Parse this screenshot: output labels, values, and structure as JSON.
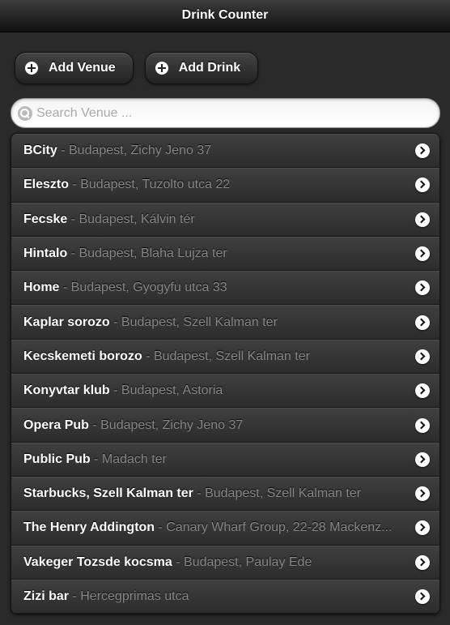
{
  "header": {
    "title": "Drink Counter"
  },
  "toolbar": {
    "add_venue_label": "Add Venue",
    "add_drink_label": "Add Drink"
  },
  "search": {
    "placeholder": "Search Venue ...",
    "value": ""
  },
  "venues": [
    {
      "name": "BCity",
      "address": "Budapest, Zichy Jeno 37"
    },
    {
      "name": "Eleszto",
      "address": "Budapest, Tuzolto utca 22"
    },
    {
      "name": "Fecske",
      "address": "Budapest, Kálvin tér"
    },
    {
      "name": "Hintalo",
      "address": "Budapest, Blaha Lujza ter"
    },
    {
      "name": "Home",
      "address": "Budapest, Gyogyfu utca 33"
    },
    {
      "name": "Kaplar sorozo",
      "address": "Budapest, Szell Kalman ter"
    },
    {
      "name": "Kecskemeti borozo",
      "address": "Budapest, Szell Kalman ter"
    },
    {
      "name": "Konyvtar klub",
      "address": "Budapest, Astoria"
    },
    {
      "name": "Opera Pub",
      "address": "Budapest, Zichy Jeno 37"
    },
    {
      "name": "Public Pub",
      "address": "Madach ter"
    },
    {
      "name": "Starbucks, Szell Kalman ter",
      "address": "Budapest, Szell Kalman ter"
    },
    {
      "name": "The Henry Addington",
      "address": "Canary Wharf Group, 22-28 Mackenz..."
    },
    {
      "name": "Vakeger Tozsde kocsma",
      "address": "Budapest, Paulay Ede"
    },
    {
      "name": "Zizi bar",
      "address": "Hercegprimas utca"
    }
  ],
  "separator": " - "
}
